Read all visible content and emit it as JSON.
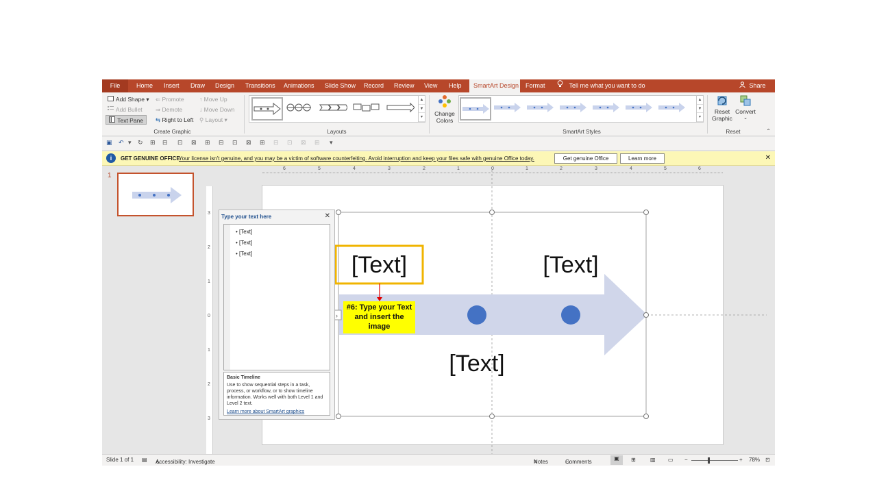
{
  "tabs": {
    "file": "File",
    "items": [
      "Home",
      "Insert",
      "Draw",
      "Design",
      "Transitions",
      "Animations",
      "Slide Show",
      "Record",
      "Review",
      "View",
      "Help",
      "SmartArt Design",
      "Format"
    ],
    "tell_me": "Tell me what you want to do",
    "share": "Share"
  },
  "ribbon": {
    "create_graphic": {
      "add_shape": "Add Shape",
      "add_bullet": "Add Bullet",
      "text_pane": "Text Pane",
      "promote": "Promote",
      "demote": "Demote",
      "right_to_left": "Right to Left",
      "move_up": "Move Up",
      "move_down": "Move Down",
      "layout": "Layout",
      "label": "Create Graphic"
    },
    "layouts": {
      "label": "Layouts"
    },
    "change_colors": "Change Colors",
    "smartart_styles": {
      "label": "SmartArt Styles"
    },
    "reset": {
      "reset_graphic": "Reset Graphic",
      "convert": "Convert",
      "label": "Reset"
    }
  },
  "license_bar": {
    "heading": "GET GENUINE OFFICE",
    "message": "Your license isn't genuine, and you may be a victim of software counterfeiting. Avoid interruption and keep your files safe with genuine Office today.",
    "get_genuine": "Get genuine Office",
    "learn_more": "Learn more"
  },
  "thumbnails": {
    "slide_number": "1"
  },
  "ruler": {
    "h_labels": [
      "6",
      "5",
      "4",
      "3",
      "2",
      "1",
      "0",
      "1",
      "2",
      "3",
      "4",
      "5",
      "6"
    ],
    "v_labels": [
      "3",
      "2",
      "1",
      "0",
      "1",
      "2",
      "3"
    ]
  },
  "text_pane": {
    "header": "Type your text here",
    "items": [
      "[Text]",
      "[Text]",
      "[Text]"
    ],
    "desc_title": "Basic Timeline",
    "desc_body": "Use to show sequential steps in a task, process, or workflow, or to show timeline information. Works well with both Level 1 and Level 2 text.",
    "learn_more": "Learn more about SmartArt graphics"
  },
  "smartart": {
    "text1": "[Text]",
    "text2": "[Text]",
    "text3": "[Text]"
  },
  "callout": {
    "text": "#6: Type your Text and  insert the image"
  },
  "status": {
    "slide_info": "Slide 1 of 1",
    "accessibility": "Accessibility: Investigate",
    "notes": "Notes",
    "comments": "Comments",
    "zoom": "78%"
  },
  "colors": {
    "ribbon_accent": "#b7472a",
    "arrow": "#d0d6ea",
    "dot": "#4472c4",
    "callout_bg": "#ffff00",
    "highlight_border": "#f0b400"
  }
}
